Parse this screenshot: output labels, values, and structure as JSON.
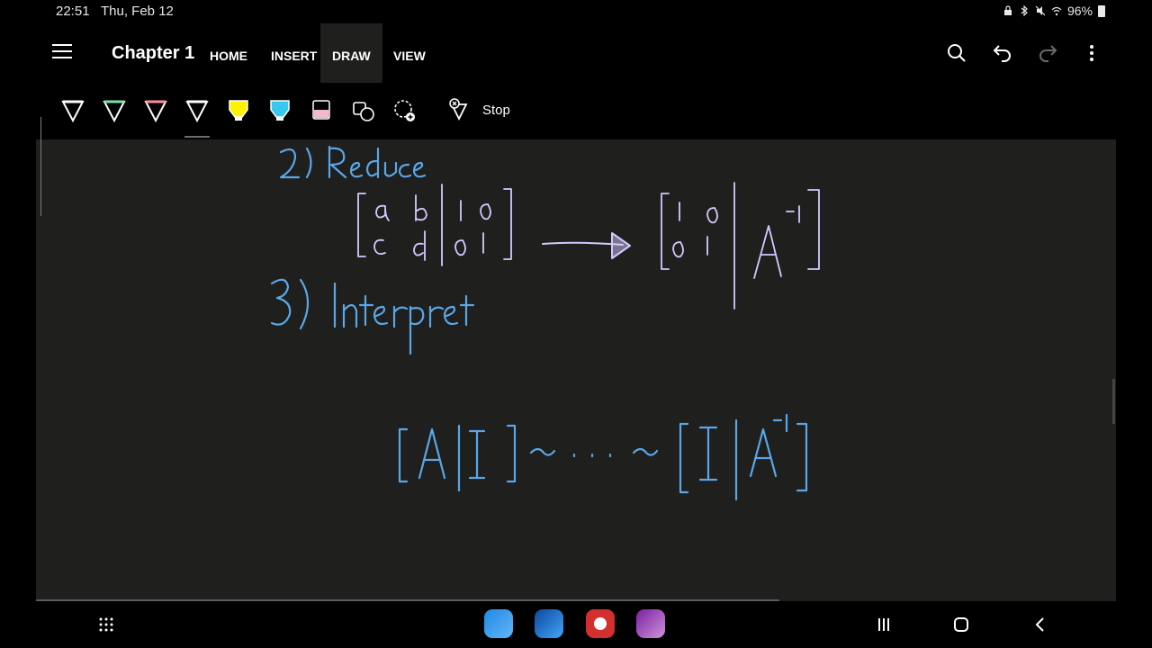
{
  "status": {
    "time": "22:51",
    "date": "Thu, Feb 12",
    "battery": "96%"
  },
  "header": {
    "title": "Chapter 1",
    "tabs": [
      {
        "label": "HOME"
      },
      {
        "label": "INSERT"
      },
      {
        "label": "DRAW",
        "active": true
      },
      {
        "label": "VIEW"
      }
    ]
  },
  "toolbar": {
    "stop_label": "Stop",
    "pens": [
      {
        "name": "pen-white",
        "color": "#ffffff"
      },
      {
        "name": "pen-green",
        "color": "#7be0a8"
      },
      {
        "name": "pen-pink",
        "color": "#ff8c9a"
      },
      {
        "name": "pen-white-selected",
        "color": "#ffffff"
      },
      {
        "name": "highlighter-yellow",
        "color": "#fff200"
      },
      {
        "name": "highlighter-cyan",
        "color": "#37c8f0"
      },
      {
        "name": "highlighter-pink",
        "color": "#f4b8c8"
      }
    ]
  },
  "ink": {
    "step2": "2) Reduce",
    "step3": "3) Interpret",
    "matrix_left": [
      [
        "a",
        "b",
        "1",
        "0"
      ],
      [
        "c",
        "d",
        "0",
        "1"
      ]
    ],
    "matrix_right": [
      [
        "1",
        "0",
        "A⁻¹"
      ],
      [
        "0",
        "1",
        ""
      ]
    ],
    "sequence": [
      "[A|I]",
      "~ . . . ~",
      "[I|A⁻¹]"
    ],
    "colors": {
      "blue": "#5aa7e8",
      "lavender": "#d6c8ff"
    }
  }
}
